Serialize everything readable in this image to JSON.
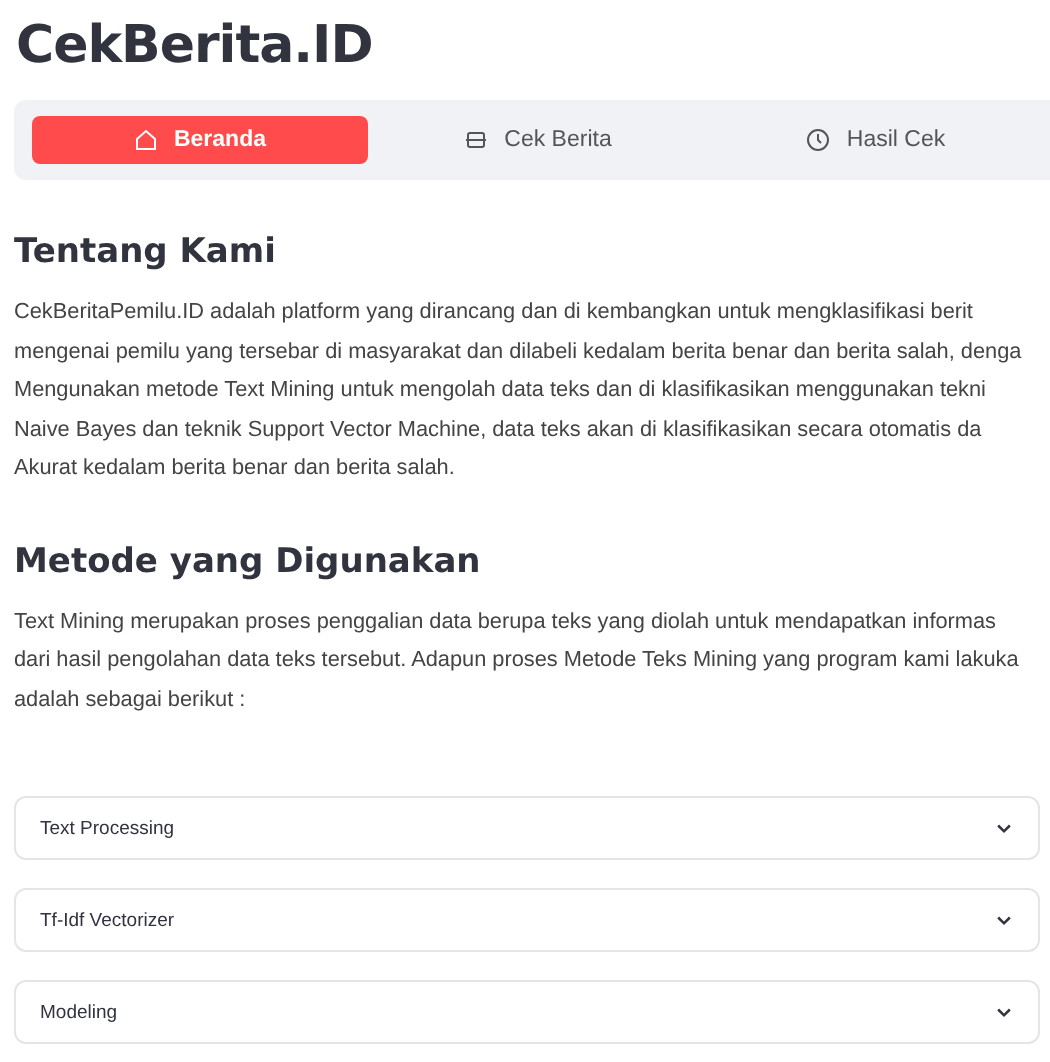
{
  "app_title": "CekBerita.ID",
  "tabs": [
    {
      "label": "Beranda",
      "kind": "home",
      "selected": true
    },
    {
      "label": "Cek Berita",
      "kind": "news",
      "selected": false
    },
    {
      "label": "Hasil Cek",
      "kind": "clock",
      "selected": false
    }
  ],
  "sections": [
    {
      "heading": "Tentang Kami",
      "lines": [
        "CekBeritaPemilu.ID adalah platform yang dirancang dan di kembangkan untuk mengklasifikasi berit",
        "mengenai pemilu yang tersebar di masyarakat dan dilabeli kedalam berita benar dan berita salah, denga",
        "Mengunakan metode Text Mining untuk mengolah data teks dan di klasifikasikan menggunakan tekni",
        "Naive Bayes dan teknik Support Vector Machine, data teks akan di klasifikasikan secara otomatis da",
        "Akurat kedalam berita benar dan berita salah."
      ]
    },
    {
      "heading": "Metode yang Digunakan",
      "lines": [
        "Text Mining merupakan proses penggalian data berupa teks yang diolah untuk mendapatkan informas",
        "dari hasil pengolahan data teks tersebut. Adapun proses Metode Teks Mining yang program kami lakuka",
        "adalah sebagai berikut :"
      ]
    }
  ],
  "accordions": [
    {
      "label": "Text Processing",
      "expanded": false
    },
    {
      "label": "Tf-Idf Vectorizer",
      "expanded": false
    },
    {
      "label": "Modeling",
      "expanded": false
    }
  ]
}
